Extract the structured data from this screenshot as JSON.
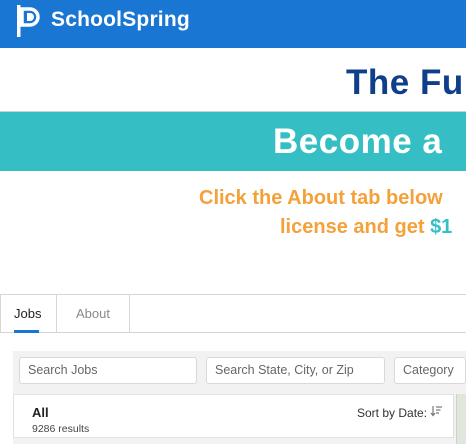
{
  "header": {
    "brand_name": "SchoolSpring",
    "logo_icon": "schoolspring-logo-icon",
    "background_color": "#1976d2"
  },
  "banner": {
    "headline_partial": "The Fu",
    "subheadline_partial": "Become a",
    "promo_line1_partial": "Click the About tab below",
    "promo_line2_partial": "license and get ",
    "promo_line2_highlight": "$1",
    "colors": {
      "navy": "#0f3f8a",
      "teal": "#35bfc4",
      "orange": "#f5a13a"
    }
  },
  "tabs": [
    {
      "label": "Jobs",
      "active": true
    },
    {
      "label": "About",
      "active": false
    }
  ],
  "search": {
    "jobs_placeholder": "Search Jobs",
    "location_placeholder": "Search State, City, or Zip",
    "category_placeholder": "Category"
  },
  "results": {
    "filter_label": "All",
    "count_text": "9286 results",
    "sort_label": "Sort by Date:",
    "sort_icon": "sort-descending-icon"
  }
}
